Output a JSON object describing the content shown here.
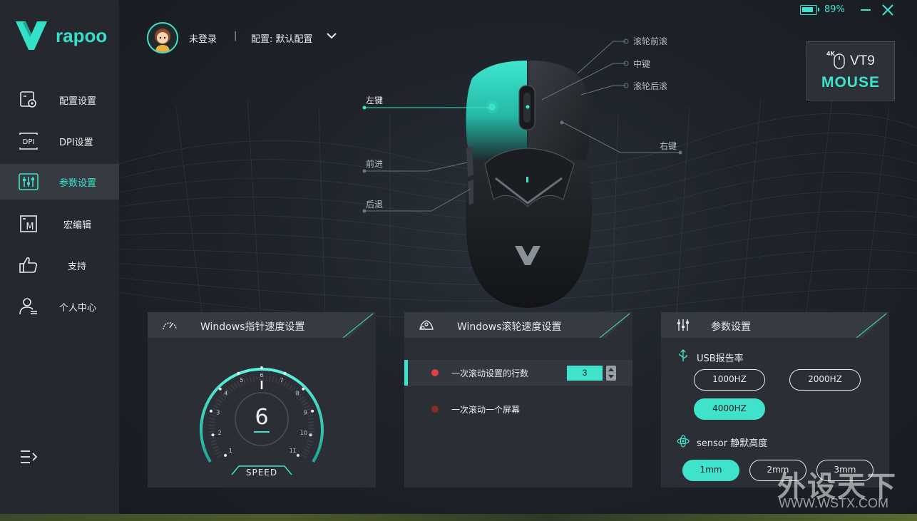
{
  "app": {
    "brand": "rapoo"
  },
  "status": {
    "battery_percent": 89,
    "battery_text": "89%"
  },
  "user": {
    "login_status": "未登录",
    "separator": "|",
    "profile_label": "配置: 默认配置"
  },
  "sidebar": {
    "items": [
      {
        "label": "配置设置",
        "icon": "config-icon",
        "active": false
      },
      {
        "label": "DPI设置",
        "icon": "dpi-icon",
        "active": false
      },
      {
        "label": "参数设置",
        "icon": "sliders-icon",
        "active": true
      },
      {
        "label": "宏编辑",
        "icon": "macro-icon",
        "active": false
      },
      {
        "label": "支持",
        "icon": "thumbs-up-icon",
        "active": false
      },
      {
        "label": "个人中心",
        "icon": "user-icon",
        "active": false
      }
    ]
  },
  "device": {
    "resolution_badge": "4K",
    "model": "VT9",
    "type_label": "MOUSE"
  },
  "callouts": {
    "left_button": "左键",
    "forward": "前进",
    "back": "后退",
    "scroll_up": "滚轮前滚",
    "middle": "中键",
    "scroll_down": "滚轮后滚",
    "right_button": "右键"
  },
  "pointer_panel": {
    "title": "Windows指针速度设置",
    "value": "6",
    "label": "SPEED",
    "ticks": [
      "1",
      "2",
      "3",
      "4",
      "5",
      "6",
      "7",
      "8",
      "9",
      "10",
      "11"
    ]
  },
  "scroll_panel": {
    "title": "Windows滚轮速度设置",
    "option_lines": "一次滚动设置的行数",
    "lines_value": "3",
    "option_screen": "一次滚动一个屏幕",
    "selected": "lines"
  },
  "params_panel": {
    "title": "参数设置",
    "usb_label": "USB报告率",
    "usb_options": [
      "1000HZ",
      "2000HZ",
      "4000HZ"
    ],
    "usb_selected": "4000HZ",
    "sensor_label": "sensor 静默高度",
    "sensor_options": [
      "1mm",
      "2mm",
      "3mm"
    ],
    "sensor_selected": "1mm"
  },
  "colors": {
    "accent": "#3fe3cc",
    "sidebar": "#25292f",
    "panel": "#2b2f35",
    "radio_red": "#e04040"
  },
  "watermark": {
    "cn": "外设天下",
    "en": "WWW.WSTX.COM"
  }
}
